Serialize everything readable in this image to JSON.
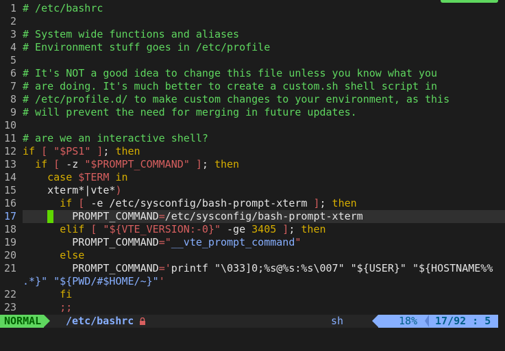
{
  "colors": {
    "background": "#1c1c1c",
    "comment": "#5fd75f",
    "keyword": "#d7af00",
    "string": "#d75f5f",
    "variable": "#87afff",
    "mode_bg": "#5fd75f",
    "status_accent": "#87afff"
  },
  "editor": {
    "lines": [
      {
        "num": "1",
        "segments": [
          {
            "t": "# /etc/bashrc",
            "c": "comment"
          }
        ]
      },
      {
        "num": "2",
        "segments": []
      },
      {
        "num": "3",
        "segments": [
          {
            "t": "# System wide functions and aliases",
            "c": "comment"
          }
        ]
      },
      {
        "num": "4",
        "segments": [
          {
            "t": "# Environment stuff goes in /etc/profile",
            "c": "comment"
          }
        ]
      },
      {
        "num": "5",
        "segments": []
      },
      {
        "num": "6",
        "segments": [
          {
            "t": "# It's NOT a good idea to change this file unless you know what you",
            "c": "comment"
          }
        ]
      },
      {
        "num": "7",
        "segments": [
          {
            "t": "# are doing. It's much better to create a custom.sh shell script in",
            "c": "comment"
          }
        ]
      },
      {
        "num": "8",
        "segments": [
          {
            "t": "# /etc/profile.d/ to make custom changes to your environment, as this",
            "c": "comment"
          }
        ]
      },
      {
        "num": "9",
        "segments": [
          {
            "t": "# will prevent the need for merging in future updates.",
            "c": "comment"
          }
        ]
      },
      {
        "num": "10",
        "segments": []
      },
      {
        "num": "11",
        "segments": [
          {
            "t": "# are we an interactive shell?",
            "c": "comment"
          }
        ]
      },
      {
        "num": "12",
        "segments": [
          {
            "t": "if",
            "c": "kw"
          },
          {
            "t": " [ ",
            "c": "str"
          },
          {
            "t": "\"",
            "c": "str"
          },
          {
            "t": "$PS1",
            "c": "str"
          },
          {
            "t": "\"",
            "c": "str"
          },
          {
            "t": " ]",
            "c": "str"
          },
          {
            "t": "; ",
            "c": "plain"
          },
          {
            "t": "then",
            "c": "kw"
          }
        ]
      },
      {
        "num": "13",
        "segments": [
          {
            "t": "  ",
            "c": "plain"
          },
          {
            "t": "if",
            "c": "kw"
          },
          {
            "t": " [ ",
            "c": "str"
          },
          {
            "t": "-z ",
            "c": "plain"
          },
          {
            "t": "\"",
            "c": "str"
          },
          {
            "t": "$PROMPT_COMMAND",
            "c": "str"
          },
          {
            "t": "\"",
            "c": "str"
          },
          {
            "t": " ]",
            "c": "str"
          },
          {
            "t": "; ",
            "c": "plain"
          },
          {
            "t": "then",
            "c": "kw"
          }
        ]
      },
      {
        "num": "14",
        "segments": [
          {
            "t": "    ",
            "c": "plain"
          },
          {
            "t": "case",
            "c": "kw"
          },
          {
            "t": " ",
            "c": "plain"
          },
          {
            "t": "$TERM",
            "c": "str"
          },
          {
            "t": " ",
            "c": "plain"
          },
          {
            "t": "in",
            "c": "kw"
          }
        ]
      },
      {
        "num": "15",
        "segments": [
          {
            "t": "    xterm*|vte*",
            "c": "plain"
          },
          {
            "t": ")",
            "c": "str"
          }
        ]
      },
      {
        "num": "16",
        "segments": [
          {
            "t": "      ",
            "c": "plain"
          },
          {
            "t": "if",
            "c": "kw"
          },
          {
            "t": " [ ",
            "c": "str"
          },
          {
            "t": "-e /etc/sysconfig/bash-prompt-xterm ",
            "c": "plain"
          },
          {
            "t": "]",
            "c": "str"
          },
          {
            "t": "; ",
            "c": "plain"
          },
          {
            "t": "then",
            "c": "kw"
          }
        ]
      },
      {
        "num": "17",
        "cursor": true,
        "segments": [
          {
            "t": "        ",
            "c": "plain"
          },
          {
            "t": "PROMPT_COMMAND",
            "c": "plain"
          },
          {
            "t": "=",
            "c": "str"
          },
          {
            "t": "/etc/sysconfig/bash-prompt-xterm",
            "c": "plain"
          }
        ]
      },
      {
        "num": "18",
        "segments": [
          {
            "t": "      ",
            "c": "plain"
          },
          {
            "t": "elif",
            "c": "kw"
          },
          {
            "t": " [ ",
            "c": "str"
          },
          {
            "t": "\"",
            "c": "str"
          },
          {
            "t": "${VTE_VERSION:-0}",
            "c": "str"
          },
          {
            "t": "\"",
            "c": "str"
          },
          {
            "t": " -ge ",
            "c": "plain"
          },
          {
            "t": "3405",
            "c": "kw"
          },
          {
            "t": " ]",
            "c": "str"
          },
          {
            "t": "; ",
            "c": "plain"
          },
          {
            "t": "then",
            "c": "kw"
          }
        ]
      },
      {
        "num": "19",
        "segments": [
          {
            "t": "        PROMPT_COMMAND",
            "c": "plain"
          },
          {
            "t": "=",
            "c": "str"
          },
          {
            "t": "\"",
            "c": "str"
          },
          {
            "t": "__vte_prompt_command",
            "c": "var"
          },
          {
            "t": "\"",
            "c": "str"
          }
        ]
      },
      {
        "num": "20",
        "segments": [
          {
            "t": "      ",
            "c": "plain"
          },
          {
            "t": "else",
            "c": "kw"
          }
        ]
      },
      {
        "num": "21",
        "segments": [
          {
            "t": "        PROMPT_COMMAND",
            "c": "plain"
          },
          {
            "t": "=",
            "c": "str"
          },
          {
            "t": "'",
            "c": "str"
          },
          {
            "t": "printf \"\\033]0;%s@%s:%s\\007\" \"${USER}\" \"${HOSTNAME%%",
            "c": "plain"
          }
        ]
      },
      {
        "num": "",
        "wrap": true,
        "segments": [
          {
            "t": ".*}\" \"${PWD/#$HOME/~}\"",
            "c": "var"
          },
          {
            "t": "'",
            "c": "str"
          }
        ]
      },
      {
        "num": "22",
        "segments": [
          {
            "t": "      ",
            "c": "plain"
          },
          {
            "t": "fi",
            "c": "kw"
          }
        ]
      },
      {
        "num": "23",
        "segments": [
          {
            "t": "      ",
            "c": "plain"
          },
          {
            "t": ";;",
            "c": "str"
          }
        ]
      }
    ]
  },
  "statusbar": {
    "mode": "NORMAL",
    "filename": "/etc/bashrc",
    "filetype": "sh",
    "percent": "18%",
    "position": "17/92 :  5"
  }
}
